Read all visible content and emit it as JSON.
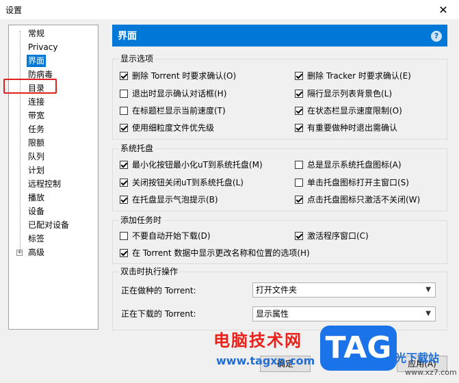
{
  "window": {
    "title": "设置",
    "close": "✕"
  },
  "tree": {
    "items": [
      "常规",
      "Privacy",
      "界面",
      "防病毒",
      "目录",
      "连接",
      "带宽",
      "任务",
      "限额",
      "队列",
      "计划",
      "远程控制",
      "播放",
      "设备",
      "已配对设备",
      "标签",
      "高级"
    ],
    "selected": "界面",
    "expander": "+"
  },
  "header": {
    "title": "界面",
    "help": "?"
  },
  "groups": {
    "display": {
      "title": "显示选项",
      "options": [
        {
          "label": "删除 Torrent 时要求确认(O)",
          "checked": true
        },
        {
          "label": "删除 Tracker 时要求确认(E)",
          "checked": true
        },
        {
          "label": "退出时显示确认对话框(H)",
          "checked": false
        },
        {
          "label": "隔行显示列表背景色(L)",
          "checked": true
        },
        {
          "label": "在标题栏显示当前速度(T)",
          "checked": false
        },
        {
          "label": "在状态栏显示速度限制(O)",
          "checked": true
        },
        {
          "label": "使用细粒度文件优先级",
          "checked": true
        },
        {
          "label": "有重要做种时退出需确认",
          "checked": true
        }
      ]
    },
    "tray": {
      "title": "系统托盘",
      "options": [
        {
          "label": "最小化按钮最小化uT到系统托盘(M)",
          "checked": true
        },
        {
          "label": "总是显示系统托盘图标(A)",
          "checked": false
        },
        {
          "label": "关闭按钮关闭uT到系统托盘(L)",
          "checked": true
        },
        {
          "label": "单击托盘图标打开主窗口(S)",
          "checked": false
        },
        {
          "label": "在托盘显示气泡提示(B)",
          "checked": true
        },
        {
          "label": "点击托盘图标只激活不关闭(W)",
          "checked": true
        }
      ]
    },
    "add": {
      "title": "添加任务时",
      "options": [
        {
          "label": "不要自动开始下载(D)",
          "checked": false
        },
        {
          "label": "激活程序窗口(C)",
          "checked": true
        },
        {
          "label": "在 Torrent 数据中显示更改名称和位置的选项(H)",
          "checked": true
        }
      ]
    },
    "dblclick": {
      "title": "双击时执行操作",
      "seeding_label": "正在做种的 Torrent:",
      "seeding_value": "打开文件夹",
      "downloading_label": "正在下载的 Torrent:",
      "downloading_value": "显示属性"
    }
  },
  "buttons": {
    "ok": "确定",
    "apply": "应用(A)"
  },
  "watermark": {
    "site": "电脑技术网",
    "url": "www.tagxp.com",
    "logo": "TAG",
    "sub": "光下载站",
    "url2": "www.xz7.com"
  }
}
